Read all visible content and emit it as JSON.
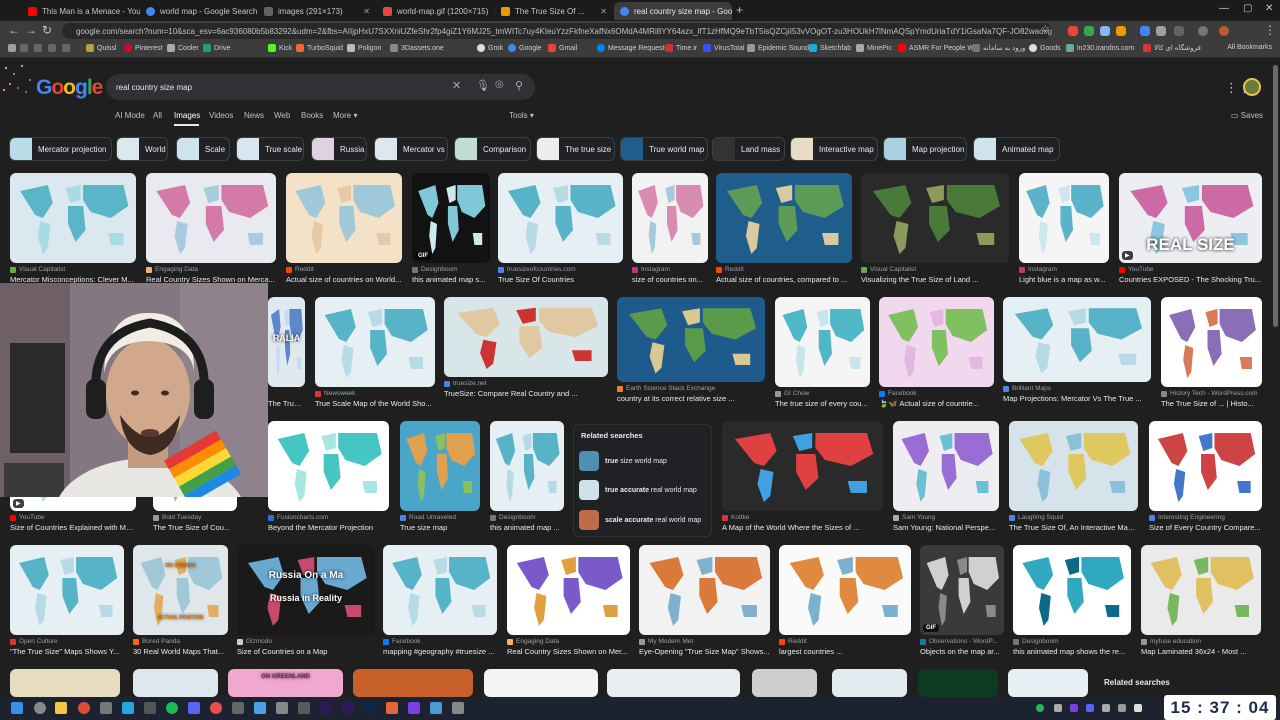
{
  "browser": {
    "tabs": [
      {
        "title": "This Man is a Menace - YouTub",
        "color": "#ff0000"
      },
      {
        "title": "world map - Google Search",
        "color": "#4285f4"
      },
      {
        "title": "images (291×173)",
        "color": "#9aa0a6"
      },
      {
        "title": "world-map.gif (1200×715)",
        "color": "#e8453c"
      },
      {
        "title": "The True Size Of ...",
        "color": "#f29900"
      },
      {
        "title": "real country size map - Googl",
        "color": "#4285f4"
      }
    ],
    "url": "google.com/search?num=10&sca_esv=6ac936080b5b83292&udm=2&fbs=AIIjpHxU7SXXniUZfeShr2fp4giZ1Y6MJ25_tmWITc7uy4KIeuYzzFkfneXafNx6OMdA4MRi8YY64azx_lfT1zHfMQ9eTbT5isQZCjiI53vVOgOT-zu3HOUkH7lNmAQSpYmdUriaTdY1iGsaNa7QF-JO82waoxgtWKdX9gjY91Igfv5NbXbwlCehIhU3LSuvrCU6...",
    "bookmarks": [
      "Quissl",
      "Pinterest",
      "Cooler",
      "Drive",
      "Kick",
      "TurboSquid",
      "Poligon",
      "3Dassets.one",
      "Grok",
      "Google",
      "Gmail",
      "Message Requests",
      "Time.ir",
      "VirusTotal",
      "Epidemic Sound",
      "Sketchfab",
      "MinePic",
      "ASMR For People W...",
      "ورود به سامانه",
      "Goods",
      "ln230.irandns.com",
      "فروشگاه ای کالا"
    ],
    "all_bookmarks": "All Bookmarks"
  },
  "google": {
    "logo": "Google",
    "query": "real country size map",
    "tabs": [
      "AI Mode",
      "All",
      "Images",
      "Videos",
      "News",
      "Web",
      "Books",
      "More"
    ],
    "tools": "Tools",
    "saves": "Saves",
    "chips": [
      "Mercator projection",
      "World",
      "Scale",
      "True scale",
      "Russia",
      "Mercator vs",
      "Comparison",
      "The true size",
      "True world map",
      "Land mass",
      "Interactive map",
      "Map projection",
      "Animated map"
    ],
    "results": [
      {
        "source": "Visual Capitalist",
        "title": "Mercator Misconceptions: Clever M..."
      },
      {
        "source": "Engaging Data",
        "title": "Real Country Sizes Shown on Merca..."
      },
      {
        "source": "Reddit",
        "title": "Actual size of countries on World..."
      },
      {
        "source": "Designboom",
        "title": "this animated map s..."
      },
      {
        "source": "truesizeofcountries.com",
        "title": "True Size Of Countries"
      },
      {
        "source": "Instagram",
        "title": "size of countries on..."
      },
      {
        "source": "Reddit",
        "title": "Actual size of countries, compared to ..."
      },
      {
        "source": "Visual Capitalist",
        "title": "Visualizing the True Size of Land ..."
      },
      {
        "source": "Instagram",
        "title": "Light blue is a map as w..."
      },
      {
        "source": "YouTube",
        "title": "Countries EXPOSED - The Shocking Tru..."
      },
      {
        "source": "",
        "title": "The True ..."
      },
      {
        "source": "Newsweek",
        "title": "True Scale Map of the World Sho..."
      },
      {
        "source": "truesize.net",
        "title": "TrueSize: Compare Real Country and ..."
      },
      {
        "source": "Earth Science Stack Exchange",
        "title": "country at its correct relative size ..."
      },
      {
        "source": "GI Chow",
        "title": "The true size of every cou..."
      },
      {
        "source": "Facebook",
        "title": "🍃🦋 Actual size of countrie..."
      },
      {
        "source": "Brilliant Maps",
        "title": "Map Projections: Mercator Vs The True ..."
      },
      {
        "source": "History Tech - WordPress.com",
        "title": "The True Size of ... | Histo..."
      },
      {
        "source": "YouTube",
        "title": "Size of Countries Explained with Map..."
      },
      {
        "source": "Bold Tuesday",
        "title": "The True Size of Cou..."
      },
      {
        "source": "Fusioncharts.com",
        "title": "Beyond the Mercator Projection"
      },
      {
        "source": "Road Unraveled",
        "title": "True size map"
      },
      {
        "source": "Designboom",
        "title": "this animated map ..."
      },
      {
        "source": "Kottke",
        "title": "A Map of the World Where the Sizes of ..."
      },
      {
        "source": "Sam Young",
        "title": "Sam Young: National Perspe..."
      },
      {
        "source": "Laughing Squid",
        "title": "The True Size Of, An Interactive Map..."
      },
      {
        "source": "Interesting Engineering",
        "title": "Size of Every Country Compare..."
      },
      {
        "source": "Open Culture",
        "title": "\"The True Size\" Maps Shows Y..."
      },
      {
        "source": "Bored Panda",
        "title": "30 Real World Maps That..."
      },
      {
        "source": "Gizmodo",
        "title": "Size of Countries on a Map"
      },
      {
        "source": "Facebook",
        "title": "mapping #geography #truesize ..."
      },
      {
        "source": "Engaging Data",
        "title": "Real Country Sizes Shown on Mer..."
      },
      {
        "source": "My Modern Met",
        "title": "Eye-Opening \"True Size Map\" Shows..."
      },
      {
        "source": "Reddit",
        "title": "largest countries ..."
      },
      {
        "source": "Observations - WordP...",
        "title": "Objects on the map ar..."
      },
      {
        "source": "Designboom",
        "title": "this animated map shows the re..."
      },
      {
        "source": "myfuse education",
        "title": "Map Laminated 36x24 - Most ..."
      }
    ],
    "overlays": {
      "real_size": "REAL SIZE",
      "russia_map": "Russia On a Ma",
      "russia_reality": "Russia in Reality",
      "gif": "GIF",
      "australia": "RALIA",
      "on_canada": "ON CANADA",
      "actual_position": "ACTUAL POSITION",
      "on_greenland": "ON GREENLAND"
    },
    "related": {
      "title": "Related searches",
      "items": [
        {
          "q": "true",
          "rest": "size world map"
        },
        {
          "q": "true accurate",
          "rest": "real world map"
        },
        {
          "q": "scale accurate",
          "rest": "real world map"
        }
      ],
      "bottom_title": "Related searches"
    }
  },
  "clock": "15 : 37 : 04"
}
